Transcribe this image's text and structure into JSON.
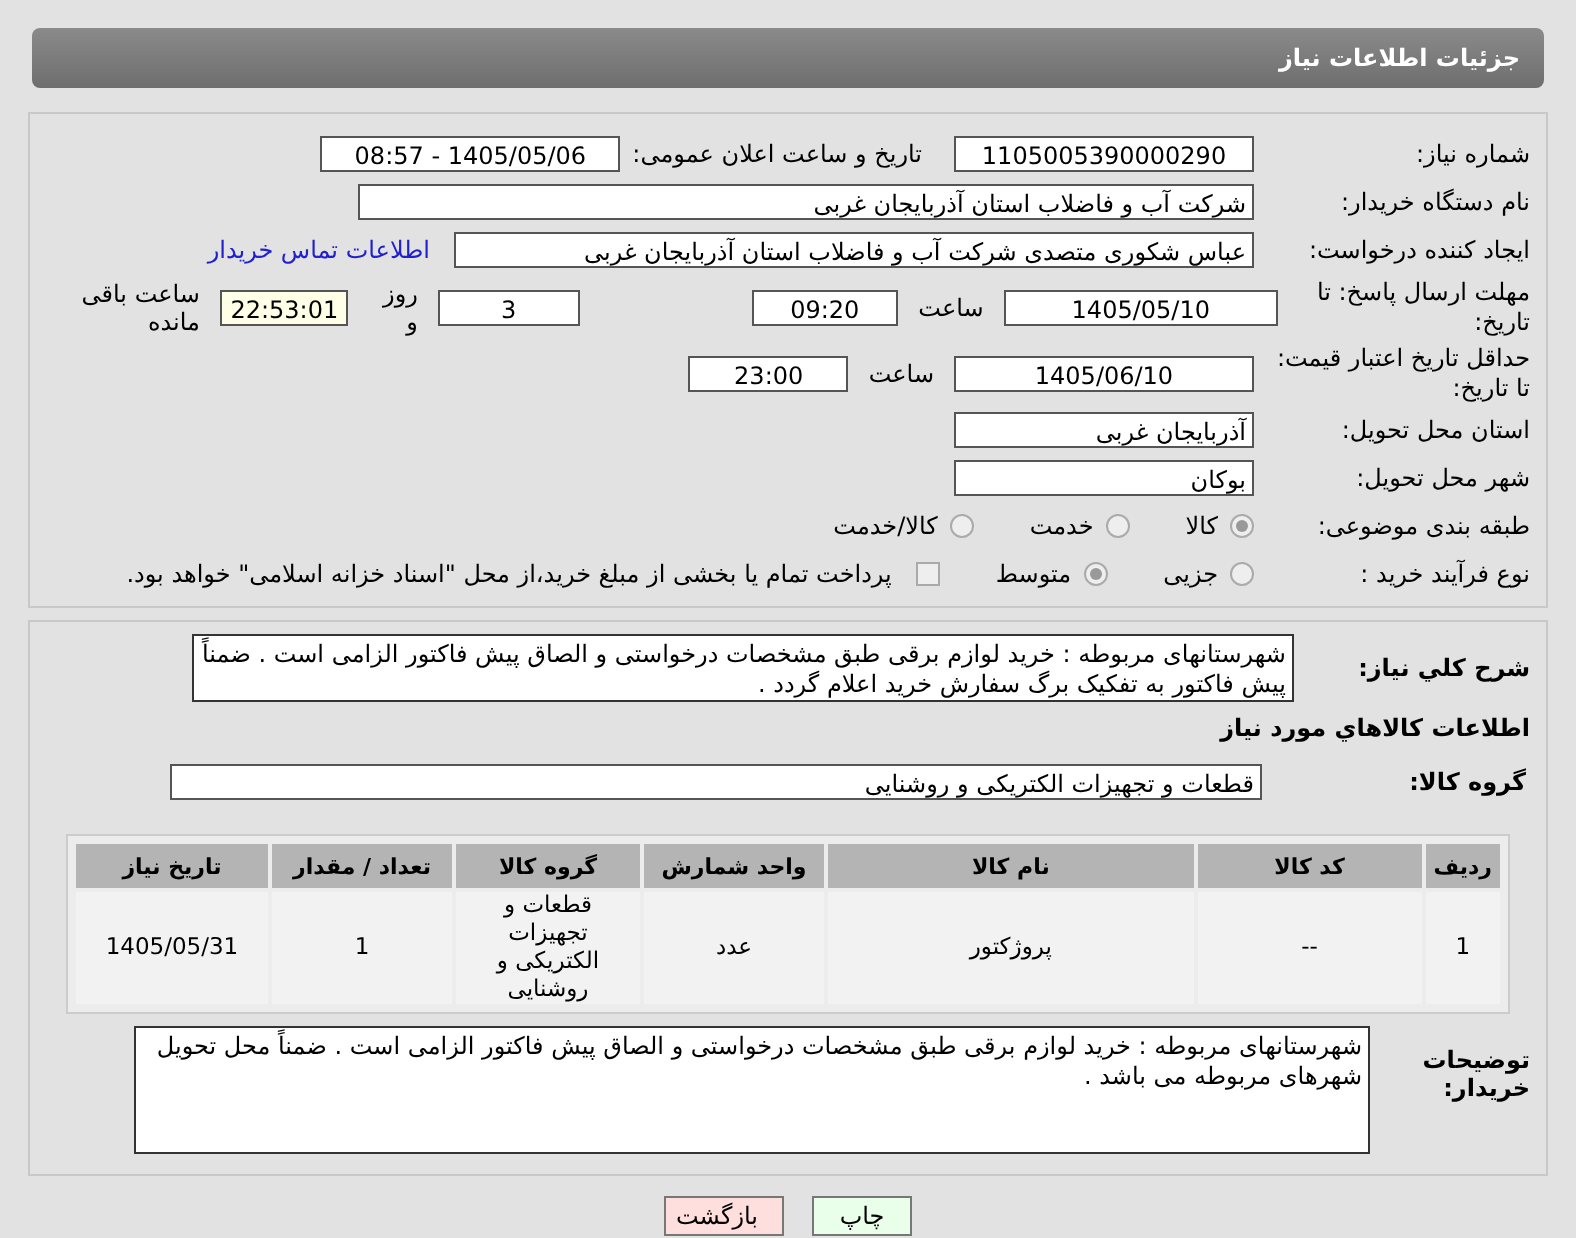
{
  "header": {
    "title": "جزئیات اطلاعات نیاز"
  },
  "need_number": {
    "label": "شماره نیاز:",
    "value": "1105005390000290"
  },
  "announce": {
    "label": "تاریخ و ساعت اعلان عمومی:",
    "value": "1405/05/06 - 08:57"
  },
  "buyer_org": {
    "label": "نام دستگاه خریدار:",
    "value": "شرکت آب و فاضلاب استان آذربایجان غربی"
  },
  "requester": {
    "label": "ایجاد کننده درخواست:",
    "value": "عباس شکوری متصدی  شرکت آب و فاضلاب استان آذربایجان غربی",
    "link": "اطلاعات تماس خریدار"
  },
  "deadline": {
    "label": "مهلت ارسال پاسخ: تا تاریخ:",
    "date": "1405/05/10",
    "time_label": "ساعت",
    "time": "09:20",
    "days": "3",
    "days_label": "روز و",
    "remaining": "22:53:01",
    "remaining_label": "ساعت باقی مانده"
  },
  "validity": {
    "label": "حداقل تاریخ اعتبار قیمت: تا تاریخ:",
    "date": "1405/06/10",
    "time_label": "ساعت",
    "time": "23:00"
  },
  "province": {
    "label": "استان محل تحویل:",
    "value": "آذربایجان غربی"
  },
  "city": {
    "label": "شهر محل تحویل:",
    "value": "بوکان"
  },
  "category": {
    "label": "طبقه بندی موضوعی:",
    "options": [
      {
        "label": "کالا",
        "selected": true
      },
      {
        "label": "خدمت",
        "selected": false
      },
      {
        "label": "کالا/خدمت",
        "selected": false
      }
    ]
  },
  "process": {
    "label": "نوع فرآیند خرید :",
    "options": [
      {
        "label": "جزیی",
        "selected": false
      },
      {
        "label": "متوسط",
        "selected": true
      }
    ],
    "payment": {
      "checked": false,
      "text": "پرداخت تمام یا بخشی از مبلغ خرید،از محل \"اسناد خزانه اسلامی\" خواهد بود."
    }
  },
  "description": {
    "label": "شرح کلي نیاز:",
    "value": "شهرستانهای مربوطه  : خرید  لوازم برقی   طبق مشخصات درخواستی و الصاق پیش فاکتور الزامی است . ضمناً پیش فاکتور به تفکیک برگ سفارش خرید اعلام گردد ."
  },
  "goods": {
    "title": "اطلاعات کالاهاي مورد نیاز",
    "group_label": "گروه کالا:",
    "group": "قطعات و تجهیزات الکتریکی و روشنایی"
  },
  "table": {
    "columns": [
      "ردیف",
      "کد کالا",
      "نام کالا",
      "واحد شمارش",
      "گروه کالا",
      "تعداد / مقدار",
      "تاریخ نیاز"
    ],
    "rows": [
      [
        "1",
        "--",
        "پروژکتور",
        "عدد",
        "قطعات و تجهیزات الکتریکی و روشنایی",
        "1",
        "1405/05/31"
      ]
    ]
  },
  "buyer_notes": {
    "label": "توضیحات خریدار:",
    "value": "شهرستانهای مربوطه  : خرید  لوازم برقی   طبق مشخصات درخواستی و الصاق پیش فاکتور الزامی است . ضمناً محل تحویل شهرهای مربوطه می باشد ."
  },
  "buttons": [
    {
      "label": "چاپ",
      "kind": "print"
    },
    {
      "label": "بازگشت",
      "kind": "back"
    }
  ]
}
